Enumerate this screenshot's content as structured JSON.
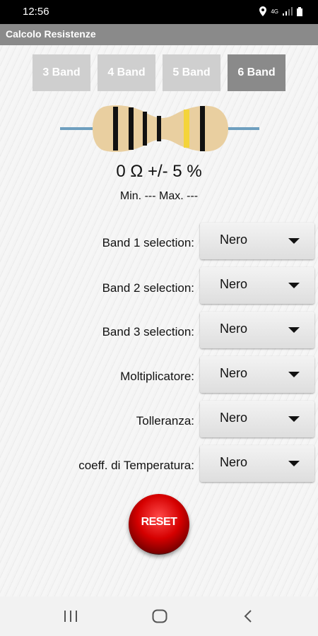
{
  "status_bar": {
    "time": "12:56",
    "network_label": "4G"
  },
  "app_bar": {
    "title": "Calcolo Resistenze"
  },
  "tabs": [
    {
      "label": "3 Band",
      "active": false
    },
    {
      "label": "4 Band",
      "active": false
    },
    {
      "label": "5 Band",
      "active": false
    },
    {
      "label": "6 Band",
      "active": true
    }
  ],
  "resistor": {
    "value_text": "0 Ω +/- 5 %",
    "minmax_text": "Min. --- Max. ---",
    "band_colors": [
      "#111111",
      "#111111",
      "#111111",
      "#111111",
      "#f4d43a",
      "#111111"
    ],
    "body_color": "#e9cfa0",
    "lead_color": "#6e9fbf"
  },
  "selections": [
    {
      "label": "Band 1 selection:",
      "value": "Nero"
    },
    {
      "label": "Band 2 selection:",
      "value": "Nero"
    },
    {
      "label": "Band 3 selection:",
      "value": "Nero"
    },
    {
      "label": "Moltiplicatore:",
      "value": "Nero"
    },
    {
      "label": "Tolleranza:",
      "value": "Nero"
    },
    {
      "label": "coeff. di Temperatura:",
      "value": "Nero"
    }
  ],
  "reset_button": {
    "label": "RESET"
  }
}
